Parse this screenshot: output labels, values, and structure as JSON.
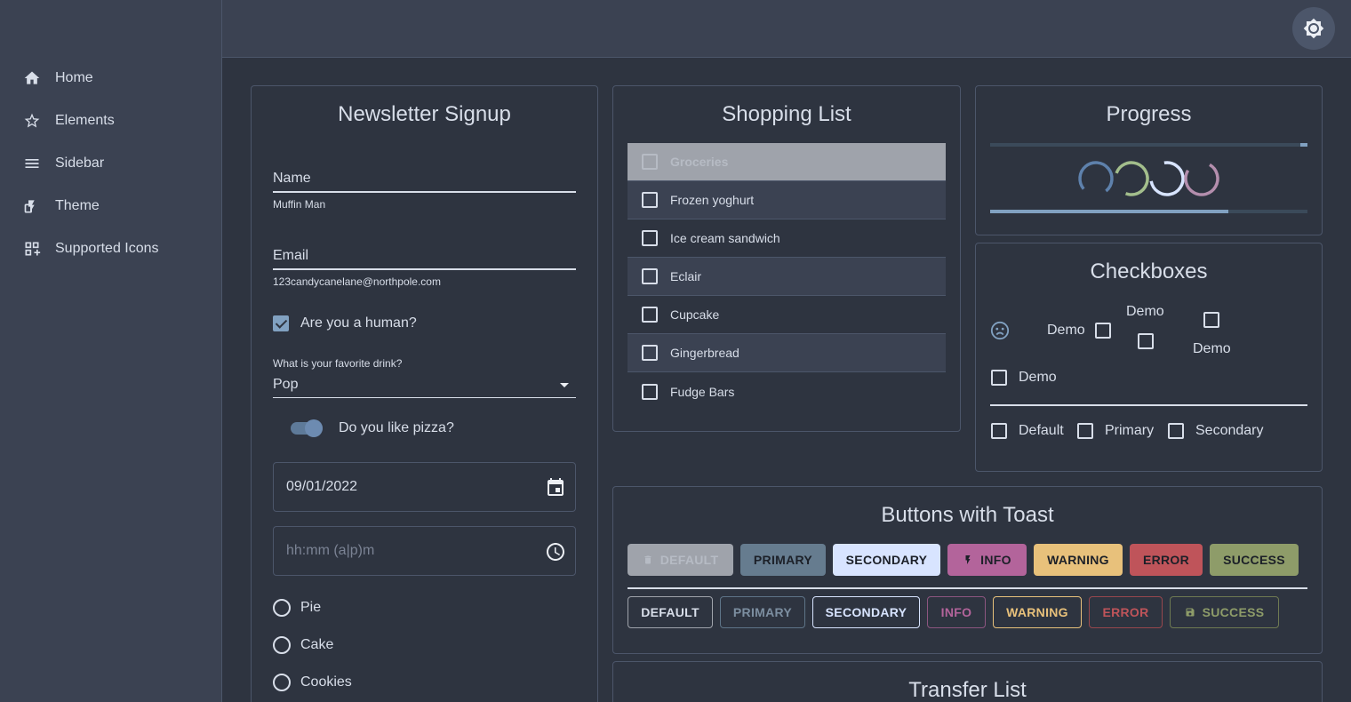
{
  "sidebar": {
    "items": [
      {
        "label": "Home",
        "icon": "home-icon"
      },
      {
        "label": "Elements",
        "icon": "star-icon"
      },
      {
        "label": "Sidebar",
        "icon": "menu-icon"
      },
      {
        "label": "Theme",
        "icon": "theme-icon"
      },
      {
        "label": "Supported Icons",
        "icon": "icons-icon"
      }
    ]
  },
  "newsletter": {
    "title": "Newsletter Signup",
    "name_label": "Name",
    "name_help": "Muffin Man",
    "email_label": "Email",
    "email_help": "123candycanelane@northpole.com",
    "human_label": "Are you a human?",
    "human_checked": true,
    "drink_label": "What is your favorite drink?",
    "drink_value": "Pop",
    "pizza_label": "Do you like pizza?",
    "pizza_on": true,
    "date_value": "09/01/2022",
    "time_placeholder": "hh:mm (a|p)m",
    "radios": [
      "Pie",
      "Cake",
      "Cookies"
    ]
  },
  "shopping": {
    "title": "Shopping List",
    "header": "Groceries",
    "items": [
      "Frozen yoghurt",
      "Ice cream sandwich",
      "Eclair",
      "Cupcake",
      "Gingerbread",
      "Fudge Bars"
    ]
  },
  "progress": {
    "title": "Progress",
    "linear_value": 0.75
  },
  "checkboxes": {
    "title": "Checkboxes",
    "demo": "Demo",
    "options": [
      "Default",
      "Primary",
      "Secondary"
    ]
  },
  "buttons": {
    "title": "Buttons with Toast",
    "contained": [
      "DEFAULT",
      "PRIMARY",
      "SECONDARY",
      "INFO",
      "WARNING",
      "ERROR",
      "SUCCESS"
    ],
    "outlined": [
      "DEFAULT",
      "PRIMARY",
      "SECONDARY",
      "INFO",
      "WARNING",
      "ERROR",
      "SUCCESS"
    ]
  },
  "transfer": {
    "title": "Transfer List"
  },
  "colors": {
    "background": "#2e3440",
    "surface": "#3b4252",
    "primary": "#5e81ac",
    "secondary": "#d8e4ff",
    "info": "#b48ead",
    "warning": "#ebcb8b",
    "error": "#bf616a",
    "success": "#a3be8c"
  }
}
